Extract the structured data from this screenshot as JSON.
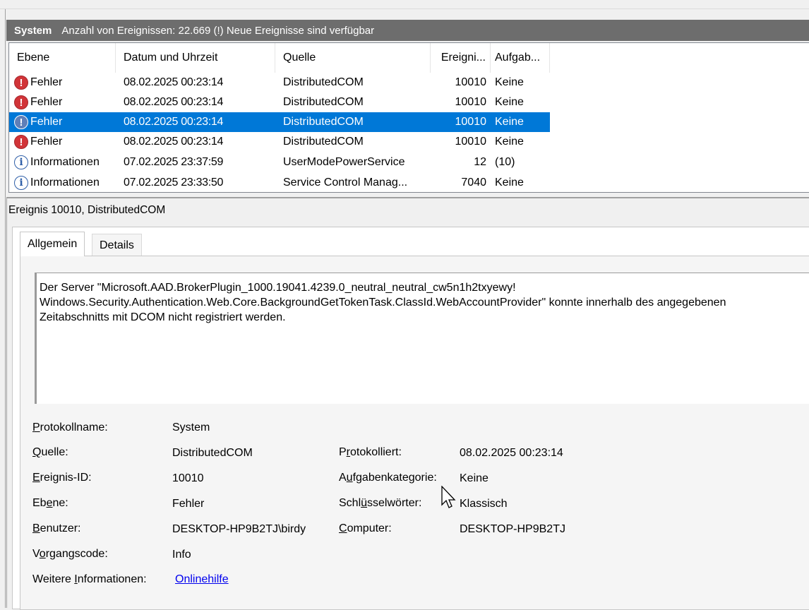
{
  "log_header": {
    "title": "System",
    "subtitle": "Anzahl von Ereignissen: 22.669 (!) Neue Ereignisse sind verfügbar"
  },
  "event_list": {
    "columns": [
      "Ebene",
      "Datum und Uhrzeit",
      "Quelle",
      "Ereigni...",
      "Aufgab..."
    ],
    "rows": [
      {
        "level": "Fehler",
        "icon": "error-icon",
        "date": "08.02.2025 00:23:14",
        "source": "DistributedCOM",
        "id": "10010",
        "task": "Keine",
        "selected": false
      },
      {
        "level": "Fehler",
        "icon": "error-icon",
        "date": "08.02.2025 00:23:14",
        "source": "DistributedCOM",
        "id": "10010",
        "task": "Keine",
        "selected": false
      },
      {
        "level": "Fehler",
        "icon": "error-icon",
        "date": "08.02.2025 00:23:14",
        "source": "DistributedCOM",
        "id": "10010",
        "task": "Keine",
        "selected": true
      },
      {
        "level": "Fehler",
        "icon": "error-icon",
        "date": "08.02.2025 00:23:14",
        "source": "DistributedCOM",
        "id": "10010",
        "task": "Keine",
        "selected": false
      },
      {
        "level": "Informationen",
        "icon": "info-icon",
        "date": "07.02.2025 23:37:59",
        "source": "UserModePowerService",
        "id": "12",
        "task": "(10)",
        "selected": false
      },
      {
        "level": "Informationen",
        "icon": "info-icon",
        "date": "07.02.2025 23:33:50",
        "source": "Service Control Manag...",
        "id": "7040",
        "task": "Keine",
        "selected": false
      }
    ]
  },
  "details": {
    "title": "Ereignis 10010, DistributedCOM",
    "tabs": {
      "general": "Allgemein",
      "details": "Details"
    },
    "description": "Der Server \"Microsoft.AAD.BrokerPlugin_1000.19041.4239.0_neutral_neutral_cw5n1h2txyewy!\nWindows.Security.Authentication.Web.Core.BackgroundGetTokenTask.ClassId.WebAccountProvider\" konnte innerhalb des angegebenen\nZeitabschnitts mit DCOM nicht registriert werden.",
    "labels": {
      "log_name": "Protokollname:",
      "source": "Quelle:",
      "event_id": "Ereignis-ID:",
      "level": "Ebene:",
      "user": "Benutzer:",
      "opcode": "Vorgangscode:",
      "more_info": "Weitere Informationen:",
      "logged": "Protokolliert:",
      "task_category": "Aufgabenkategorie:",
      "keywords": "Schlüsselwörter:",
      "computer": "Computer:"
    },
    "values": {
      "log_name": "System",
      "source": "DistributedCOM",
      "event_id": "10010",
      "level": "Fehler",
      "user": "DESKTOP-HP9B2TJ\\birdy",
      "opcode": "Info",
      "more_info_link": "Onlinehilfe",
      "logged": "08.02.2025 00:23:14",
      "task_category": "Keine",
      "keywords": "Klassisch",
      "computer": "DESKTOP-HP9B2TJ"
    }
  },
  "colors": {
    "header_bg": "#6d6d6d",
    "selection": "#0078d7",
    "error_red": "#d13438",
    "info_blue": "#2f5fa8",
    "link": "#0000ee"
  }
}
